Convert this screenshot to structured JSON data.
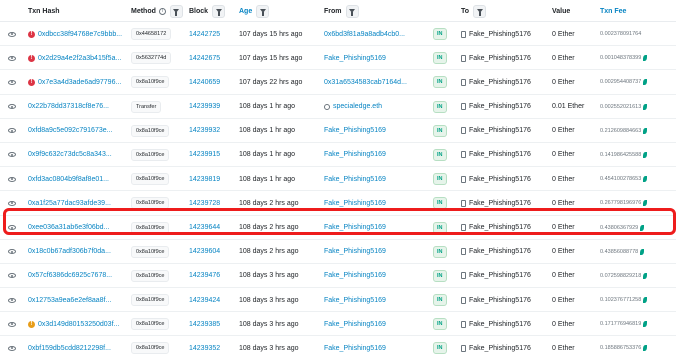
{
  "columns": {
    "txn_hash": "Txn Hash",
    "method": "Method",
    "block": "Block",
    "age": "Age",
    "from": "From",
    "to": "To",
    "value": "Value",
    "txn_fee": "Txn Fee"
  },
  "icons": {
    "row_preview": "eye-icon",
    "filter": "funnel-icon",
    "alert_red": "exclamation-circle-icon",
    "alert_orange": "exclamation-circle-icon",
    "contract": "contract-icon",
    "document": "document-icon",
    "gas": "leaf-icon"
  },
  "colors": {
    "link": "#0784c3",
    "in_badge": "#00a186",
    "alert_red": "#dc3545",
    "alert_orange": "#e79d1a",
    "highlight": "#ee1c1c"
  },
  "rows": [
    {
      "hash": "0xdbcc38f94768e7c9bbb...",
      "alert": "red",
      "method": "0x44658172",
      "block": "14242725",
      "age": "107 days 15 hrs ago",
      "from": "0x6bd3f81a9a8adb4cb0...",
      "from_link": true,
      "from_contract": false,
      "direction": "IN",
      "to": "Fake_Phishing5176",
      "value": "0 Ether",
      "fee": "0.002378091764",
      "fee_leaf": false
    },
    {
      "hash": "0x2d29a4e2f2a3b415f5a...",
      "alert": "red",
      "method": "0x5632774d",
      "block": "14242675",
      "age": "107 days 15 hrs ago",
      "from": "Fake_Phishing5169",
      "from_link": true,
      "from_contract": false,
      "direction": "IN",
      "to": "Fake_Phishing5176",
      "value": "0 Ether",
      "fee": "0.001048378399",
      "fee_leaf": true
    },
    {
      "hash": "0x7e3a4d3ade6ad97796...",
      "alert": "red",
      "method": "0x8a10f9ce",
      "block": "14240659",
      "age": "107 days 22 hrs ago",
      "from": "0x31a6534583cab7164d...",
      "from_link": true,
      "from_contract": false,
      "direction": "IN",
      "to": "Fake_Phishing5176",
      "value": "0 Ether",
      "fee": "0.002954408737",
      "fee_leaf": true
    },
    {
      "hash": "0x22b78dd37318cf8e76...",
      "alert": "",
      "method": "Transfer",
      "block": "14239939",
      "age": "108 days 1 hr ago",
      "from": "specialedge.eth",
      "from_link": true,
      "from_contract": true,
      "direction": "IN",
      "to": "Fake_Phishing5176",
      "value": "0.01 Ether",
      "fee": "0.002552021613",
      "fee_leaf": true
    },
    {
      "hash": "0xfd8a9c5e092c791673e...",
      "alert": "",
      "method": "0x8a10f9ce",
      "block": "14239932",
      "age": "108 days 1 hr ago",
      "from": "Fake_Phishing5169",
      "from_link": true,
      "from_contract": false,
      "direction": "IN",
      "to": "Fake_Phishing5176",
      "value": "0 Ether",
      "fee": "0.212609884663",
      "fee_leaf": true
    },
    {
      "hash": "0x9f9c632c73dc5c8a343...",
      "alert": "",
      "method": "0x8a10f9ce",
      "block": "14239915",
      "age": "108 days 1 hr ago",
      "from": "Fake_Phishing5169",
      "from_link": true,
      "from_contract": false,
      "direction": "IN",
      "to": "Fake_Phishing5176",
      "value": "0 Ether",
      "fee": "0.141986425588",
      "fee_leaf": true
    },
    {
      "hash": "0xfd3ac0804b9f8af8e01...",
      "alert": "",
      "method": "0x8a10f9ce",
      "block": "14239819",
      "age": "108 days 1 hr ago",
      "from": "Fake_Phishing5169",
      "from_link": true,
      "from_contract": false,
      "direction": "IN",
      "to": "Fake_Phishing5176",
      "value": "0 Ether",
      "fee": "0.454100278653",
      "fee_leaf": true
    },
    {
      "hash": "0xa1f25a77dac93afde39...",
      "alert": "",
      "method": "0x8a10f9ce",
      "block": "14239728",
      "age": "108 days 2 hrs ago",
      "from": "Fake_Phishing5169",
      "from_link": true,
      "from_contract": false,
      "direction": "IN",
      "to": "Fake_Phishing5176",
      "value": "0 Ether",
      "fee": "0.267798196976",
      "fee_leaf": true
    },
    {
      "hash": "0xee036a31ab6e3f06bd...",
      "alert": "",
      "method": "0x8a10f9ce",
      "block": "14239644",
      "age": "108 days 2 hrs ago",
      "from": "Fake_Phishing5169",
      "from_link": true,
      "from_contract": false,
      "direction": "IN",
      "to": "Fake_Phishing5176",
      "value": "0 Ether",
      "fee": "0.43806367929",
      "fee_leaf": true,
      "highlighted": true
    },
    {
      "hash": "0x18c0b67adf306b7f0da...",
      "alert": "",
      "method": "0x8a10f9ce",
      "block": "14239604",
      "age": "108 days 2 hrs ago",
      "from": "Fake_Phishing5169",
      "from_link": true,
      "from_contract": false,
      "direction": "IN",
      "to": "Fake_Phishing5176",
      "value": "0 Ether",
      "fee": "0.43856088778",
      "fee_leaf": true
    },
    {
      "hash": "0x57cf6386dc6925c7678...",
      "alert": "",
      "method": "0x8a10f9ce",
      "block": "14239476",
      "age": "108 days 3 hrs ago",
      "from": "Fake_Phishing5169",
      "from_link": true,
      "from_contract": false,
      "direction": "IN",
      "to": "Fake_Phishing5176",
      "value": "0 Ether",
      "fee": "0.072598829218",
      "fee_leaf": true
    },
    {
      "hash": "0x12753a9ea6e2ef8aa8f...",
      "alert": "",
      "method": "0x8a10f9ce",
      "block": "14239424",
      "age": "108 days 3 hrs ago",
      "from": "Fake_Phishing5169",
      "from_link": true,
      "from_contract": false,
      "direction": "IN",
      "to": "Fake_Phishing5176",
      "value": "0 Ether",
      "fee": "0.102376771258",
      "fee_leaf": true
    },
    {
      "hash": "0x3d149d80153250d03f...",
      "alert": "orange",
      "method": "0x8a10f9ce",
      "block": "14239385",
      "age": "108 days 3 hrs ago",
      "from": "Fake_Phishing5169",
      "from_link": true,
      "from_contract": false,
      "direction": "IN",
      "to": "Fake_Phishing5176",
      "value": "0 Ether",
      "fee": "0.171776946819",
      "fee_leaf": true
    },
    {
      "hash": "0xbf159db5cdd8212298f...",
      "alert": "",
      "method": "0x8a10f9ce",
      "block": "14239352",
      "age": "108 days 3 hrs ago",
      "from": "Fake_Phishing5169",
      "from_link": true,
      "from_contract": false,
      "direction": "IN",
      "to": "Fake_Phishing5176",
      "value": "0 Ether",
      "fee": "0.185886753376",
      "fee_leaf": true
    }
  ]
}
